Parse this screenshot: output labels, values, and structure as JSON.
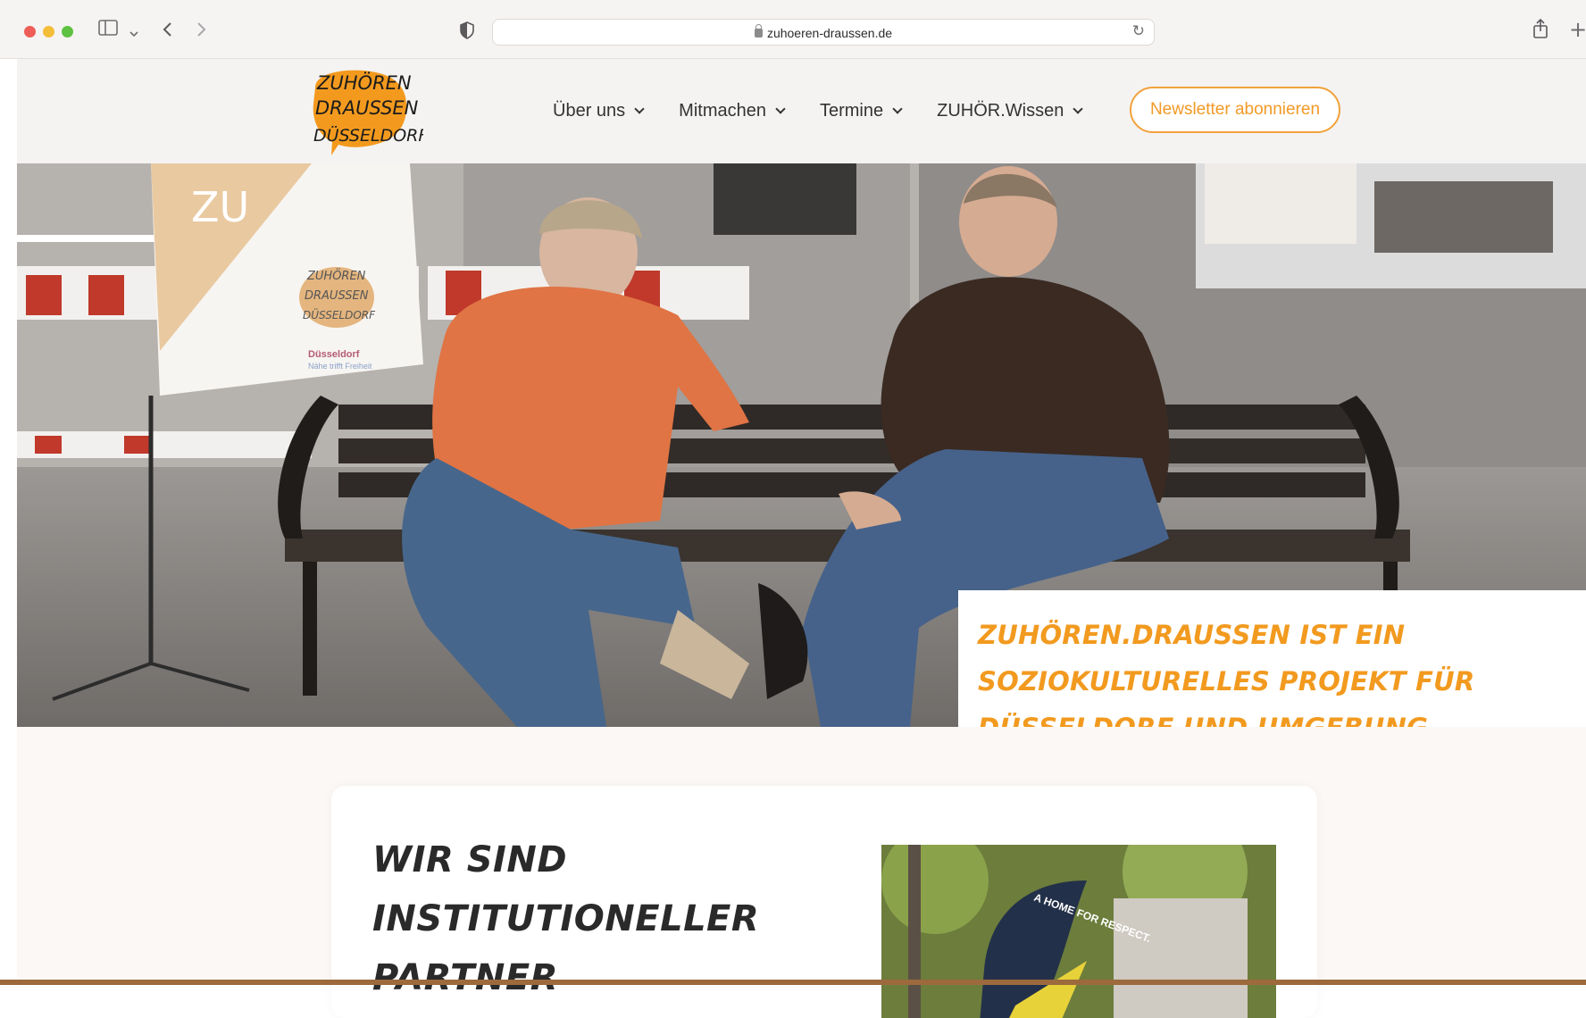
{
  "browser": {
    "url": "zuhoeren-draussen.de",
    "icons": [
      "sidebar-icon",
      "chevron-down-icon",
      "back-icon",
      "forward-icon",
      "shield-icon",
      "lock-icon",
      "reload-icon",
      "share-icon",
      "new-tab-icon"
    ]
  },
  "header": {
    "logo_lines": [
      "ZUHÖREN",
      "DRAUSSEN",
      "DÜSSELDORF"
    ],
    "nav": [
      {
        "label": "Über uns"
      },
      {
        "label": "Mitmachen"
      },
      {
        "label": "Termine"
      },
      {
        "label": "ZUHÖR.Wissen"
      }
    ],
    "newsletter_label": "Newsletter abonnieren"
  },
  "hero": {
    "caption": "Zuhören.Draussen ist ein soziokulturelles Projekt für Düsseldorf und Umgebung.",
    "flag_text": [
      "ZU",
      "ZUHÖREN",
      "DRAUSSEN",
      "DÜSSELDORF",
      "Düsseldorf",
      "Nähe trifft Freiheit"
    ]
  },
  "section": {
    "title_line1": "Wir sind",
    "title_line2": "institutioneller",
    "title_line3": "Partner",
    "photo_banner_text": "A HOME FOR RESPECT."
  },
  "colors": {
    "accent": "#f29a1f",
    "logo_orange": "#f39a1e",
    "page_bg": "#fbf8f5"
  }
}
